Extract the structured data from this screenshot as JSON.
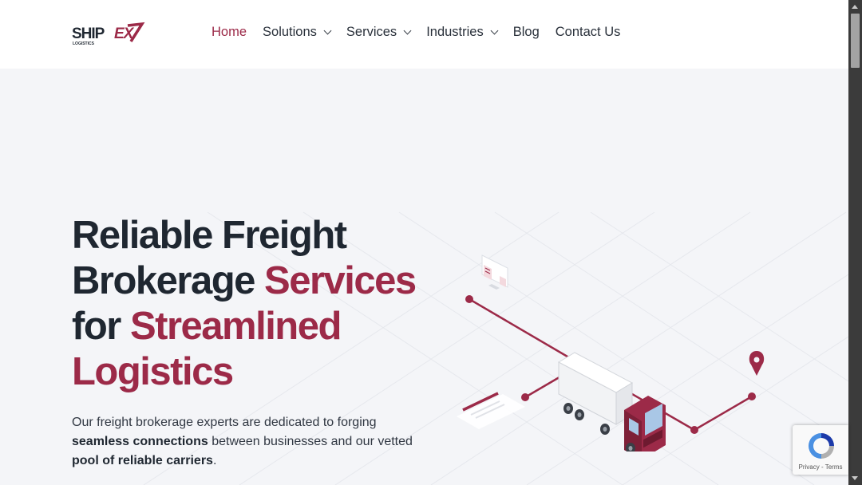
{
  "brand": {
    "name_part1": "SHIP",
    "name_part2": "EX",
    "tagline": "LOGISTICS",
    "accent_color": "#9c2a48"
  },
  "nav": {
    "items": [
      {
        "label": "Home",
        "active": true,
        "has_dropdown": false
      },
      {
        "label": "Solutions",
        "active": false,
        "has_dropdown": true
      },
      {
        "label": "Services",
        "active": false,
        "has_dropdown": true
      },
      {
        "label": "Industries",
        "active": false,
        "has_dropdown": true
      },
      {
        "label": "Blog",
        "active": false,
        "has_dropdown": false
      },
      {
        "label": "Contact Us",
        "active": false,
        "has_dropdown": false
      }
    ]
  },
  "hero": {
    "headline": {
      "line1": "Reliable Freight",
      "line2_plain": "Brokerage ",
      "line2_accent": "Services",
      "line3_plain": "for ",
      "line3_accent": "Streamlined",
      "line4_accent": "Logistics"
    },
    "description": {
      "part1": "Our freight brokerage experts are dedicated to forging ",
      "bold1": "seamless connections",
      "part2": " between businesses and our vetted ",
      "bold2": "pool of reliable carriers",
      "part3": "."
    },
    "illustration_icons": [
      "truck-icon",
      "location-pin-icon",
      "computer-monitor-icon",
      "document-icon"
    ]
  },
  "recaptcha": {
    "label": "Privacy - Terms"
  }
}
